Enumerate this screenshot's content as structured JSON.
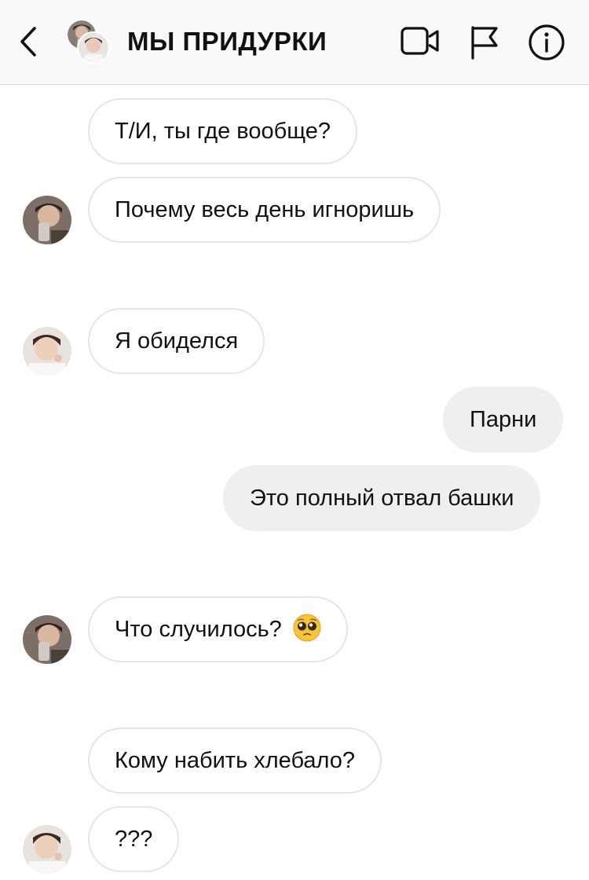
{
  "header": {
    "title": "МЫ ПРИДУРКИ",
    "icons": [
      "back-chevron-icon",
      "video-call-icon",
      "flag-icon",
      "info-icon"
    ]
  },
  "messages": [
    {
      "sender": "other",
      "text": "Т/И, ты где вообще?"
    },
    {
      "sender": "other",
      "text": "Почему весь день игноришь"
    },
    {
      "sender": "other",
      "text": "Я обиделся"
    },
    {
      "sender": "me",
      "text": "Парни"
    },
    {
      "sender": "me",
      "text": "Это полный отвал башки"
    },
    {
      "sender": "other",
      "text": "Что случилось?",
      "emoji": "pleading-face-emoji"
    },
    {
      "sender": "other",
      "text": "Кому набить хлебало?"
    },
    {
      "sender": "other",
      "text": "???"
    }
  ],
  "colors": {
    "header_bg": "#fbf8fb",
    "incoming_bubble_border": "#e6e6e6",
    "outgoing_bubble_bg": "#efefef"
  }
}
